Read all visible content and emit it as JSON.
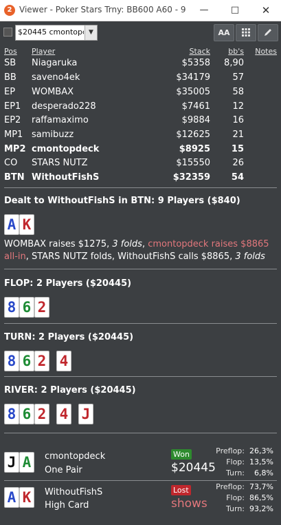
{
  "window": {
    "app_icon": "2",
    "title": "Viewer - Poker Stars Trny: BB600 A60 - 9 Play...",
    "minimize_icon": "minimize-icon",
    "maximize_icon": "maximize-icon",
    "close_icon": "close-icon"
  },
  "toolbar": {
    "hand_select_value": "$20445 cmontopdeck",
    "font_button_label": "AA",
    "grid_icon": "grid-icon",
    "edit_icon": "pencil-icon"
  },
  "table": {
    "headers": {
      "pos": "Pos",
      "player": "Player",
      "stack": "Stack",
      "bbs": "bb's",
      "notes": "Notes"
    },
    "rows": [
      {
        "pos": "SB",
        "player": "Niagaruka",
        "stack": "$5358",
        "bb": "8,90"
      },
      {
        "pos": "BB",
        "player": "saveno4ek",
        "stack": "$34179",
        "bb": "57"
      },
      {
        "pos": "EP",
        "player": "WOMBAX",
        "stack": "$35005",
        "bb": "58"
      },
      {
        "pos": "EP1",
        "player": "desperado228",
        "stack": "$7461",
        "bb": "12"
      },
      {
        "pos": "EP2",
        "player": "raffamaximo",
        "stack": "$9884",
        "bb": "16"
      },
      {
        "pos": "MP1",
        "player": "samibuzz",
        "stack": "$12625",
        "bb": "21"
      },
      {
        "pos": "MP2",
        "player": "cmontopdeck",
        "stack": "$8925",
        "bb": "15"
      },
      {
        "pos": "CO",
        "player": "STARS NUTZ",
        "stack": "$15550",
        "bb": "26"
      },
      {
        "pos": "BTN",
        "player": "WithoutFishS",
        "stack": "$32359",
        "bb": "54"
      }
    ]
  },
  "preflop": {
    "title": "Dealt to WithoutFishS in BTN: 9 Players ($840)",
    "cards": [
      {
        "rank": "A",
        "color": "#2848c8"
      },
      {
        "rank": "K",
        "color": "#c0272d"
      }
    ],
    "actions": {
      "a1": "WOMBAX raises $1275, ",
      "a1_folds": "3 folds",
      "sep1": ", ",
      "a2": "cmontopdeck raises $8865 all-in",
      "a3": ", STARS NUTZ folds, WithoutFishS calls $8865, ",
      "a3_folds": "3 folds"
    }
  },
  "flop": {
    "title": "FLOP: 2 Players ($20445)",
    "cards": [
      {
        "rank": "8",
        "color": "#2848c8"
      },
      {
        "rank": "6",
        "color": "#1e8c35"
      },
      {
        "rank": "2",
        "color": "#c0272d"
      }
    ]
  },
  "turn": {
    "title": "TURN: 2 Players ($20445)",
    "cards": [
      {
        "rank": "8",
        "color": "#2848c8"
      },
      {
        "rank": "6",
        "color": "#1e8c35"
      },
      {
        "rank": "2",
        "color": "#c0272d"
      },
      {
        "rank": "4",
        "color": "#c0272d"
      }
    ]
  },
  "river": {
    "title": "RIVER: 2 Players ($20445)",
    "cards": [
      {
        "rank": "8",
        "color": "#2848c8"
      },
      {
        "rank": "6",
        "color": "#1e8c35"
      },
      {
        "rank": "2",
        "color": "#c0272d"
      },
      {
        "rank": "4",
        "color": "#c0272d"
      },
      {
        "rank": "J",
        "color": "#c0272d"
      }
    ]
  },
  "showdown": [
    {
      "cards": [
        {
          "rank": "J",
          "color": "#111111"
        },
        {
          "rank": "A",
          "color": "#1e8c35"
        }
      ],
      "name": "cmontopdeck",
      "hand": "One Pair",
      "result": "Won",
      "result_color": "#2e8b2e",
      "amount": "$20445",
      "amount_color": "#ffffff",
      "equity": [
        {
          "label": "Preflop:",
          "value": "26,3%"
        },
        {
          "label": "Flop:",
          "value": "13,5%"
        },
        {
          "label": "Turn:",
          "value": "6,8%"
        }
      ]
    },
    {
      "cards": [
        {
          "rank": "A",
          "color": "#2848c8"
        },
        {
          "rank": "K",
          "color": "#c0272d"
        }
      ],
      "name": "WithoutFishS",
      "hand": "High Card",
      "result": "Lost",
      "result_color": "#c0272d",
      "amount": "shows",
      "amount_color": "#e2777c",
      "equity": [
        {
          "label": "Preflop:",
          "value": "73,7%"
        },
        {
          "label": "Flop:",
          "value": "86,5%"
        },
        {
          "label": "Turn:",
          "value": "93,2%"
        }
      ]
    }
  ]
}
